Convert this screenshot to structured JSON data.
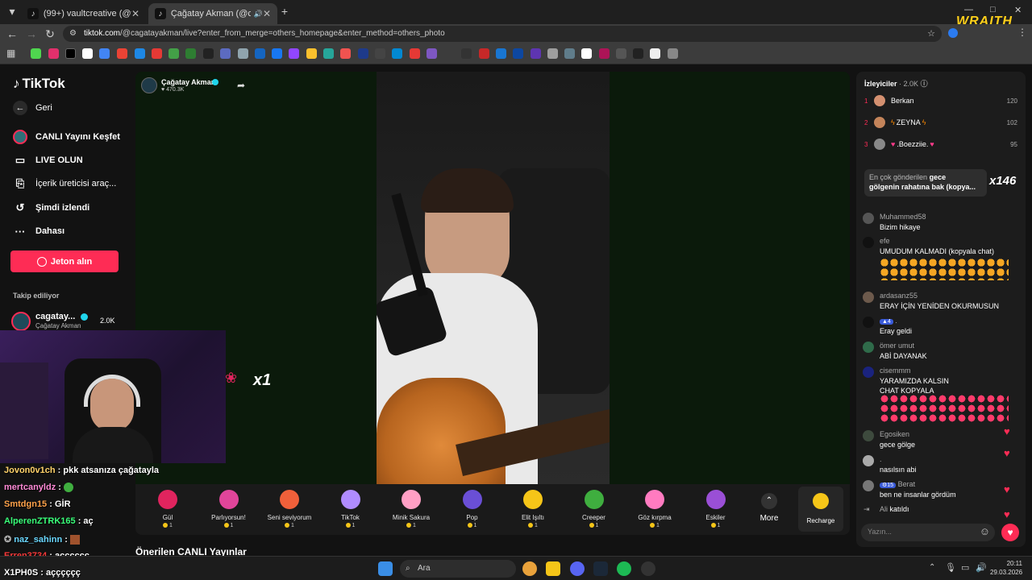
{
  "tabs": [
    {
      "title": "(99+) vaultcreative (@vaultcreat",
      "active": false
    },
    {
      "title": "Çağatay Akman (@cagatay",
      "active": true
    }
  ],
  "address": {
    "domain": "tiktok.com",
    "path": "/@cagatayakman/live?enter_from_merge=others_homepage&enter_method=others_photo"
  },
  "wraith_logo": "WRAITH",
  "sidebar": {
    "logo": "TikTok",
    "items": [
      {
        "label": "Geri",
        "icon": "arrow-left-icon"
      },
      {
        "label": "CANLI Yayını Keşfet",
        "icon": "live-explore-icon"
      },
      {
        "label": "LIVE OLUN",
        "icon": "camera-icon"
      },
      {
        "label": "İçerik üreticisi araç...",
        "icon": "creator-tools-icon"
      },
      {
        "label": "Şimdi izlendi",
        "icon": "history-icon"
      },
      {
        "label": "Dahası",
        "icon": "more-dots-icon"
      }
    ],
    "jeton_button": "Jeton alın",
    "following_title": "Takip ediliyor",
    "following": {
      "name": "cagatay...",
      "subname": "Çağatay Akman",
      "count": "2.0K"
    }
  },
  "stream": {
    "host_name": "Çağatay Akman",
    "host_likes": "470.3K",
    "gift_combo": "x1"
  },
  "gifts": [
    {
      "name": "Gül",
      "cost": "1",
      "color": "#e0245e"
    },
    {
      "name": "Parlıyorsun!",
      "cost": "1",
      "color": "#e0459a"
    },
    {
      "name": "Seni seviyorum",
      "cost": "1",
      "color": "#f0603a"
    },
    {
      "name": "TikTok",
      "cost": "1",
      "color": "#b08cff"
    },
    {
      "name": "Minik Sakura",
      "cost": "1",
      "color": "#ff9fc4"
    },
    {
      "name": "Pop",
      "cost": "1",
      "color": "#6a4fd6"
    },
    {
      "name": "Elit Işıltı",
      "cost": "1",
      "color": "#f5c518"
    },
    {
      "name": "Creeper",
      "cost": "1",
      "color": "#3fae3f"
    },
    {
      "name": "Göz kırpma",
      "cost": "1",
      "color": "#ff7bc0"
    },
    {
      "name": "Eskiler",
      "cost": "1",
      "color": "#9a4fd6"
    }
  ],
  "gift_more": "More",
  "recharge": "Recharge",
  "viewers": {
    "title": "İzleyiciler",
    "count": "2.0K",
    "ranking": [
      {
        "rank": "1",
        "name": "Berkan",
        "score": "120"
      },
      {
        "rank": "2",
        "name": "ZEYNA",
        "score": "102"
      },
      {
        "rank": "3",
        "name": ".Boezziie.",
        "score": "95"
      }
    ]
  },
  "top_message": {
    "label": "En çok gönderilen",
    "text1": "gece",
    "text2": "gölgenin rahatına bak (kopya...",
    "count": "x146"
  },
  "chat": [
    {
      "user": "Muhammed58",
      "msg": "Bizim hikaye"
    },
    {
      "user": "efe",
      "msg": "UMUDUM KALMADI (kopyala chat)"
    },
    {
      "user": "ardasanz55",
      "msg": "ERAY İÇİN YENİDEN OKURMUSUN"
    },
    {
      "user": ".",
      "badge": "4",
      "msg": "Eray geldi"
    },
    {
      "user": "ömer umut",
      "msg": "ABİ DAYANAK"
    },
    {
      "user": "cisemmm",
      "msg": "YARAMIZDA KALSIN CHAT KOPYALA"
    },
    {
      "user": "Egosiken",
      "msg": "gece gölge"
    },
    {
      "user": ".",
      "msg": "nasılsın abi"
    },
    {
      "user": "Berat",
      "badge": "15",
      "msg": "ben ne insanlar gördüm"
    },
    {
      "user": "Ali",
      "msg": "katıldı"
    }
  ],
  "chat_input_placeholder": "Yazın...",
  "suggested_title": "Önerilen CANLI Yayınlar",
  "overlay_chat": [
    {
      "user": "Jovon0v1ch",
      "msg": "pkk atsanıza çağatayla",
      "color": "#ffd36a"
    },
    {
      "user": "mertcanyldz",
      "msg": "",
      "color": "#ff8ad6"
    },
    {
      "user": "Smtdgn15",
      "msg": "GİR",
      "color": "#ffa24a"
    },
    {
      "user": "AlperenZTRK165",
      "msg": "aç",
      "color": "#3aff7a"
    },
    {
      "user": "naz_sahinn",
      "msg": "",
      "color": "#6ad7ff"
    },
    {
      "user": "Erren3734",
      "msg": "açççççç",
      "color": "#ff3b3b"
    },
    {
      "user": "X1PH0S",
      "msg": "açççççç",
      "color": "#ffffff"
    }
  ],
  "taskbar": {
    "search": "Ara",
    "time": "20:11",
    "date": "29.03.2026"
  }
}
